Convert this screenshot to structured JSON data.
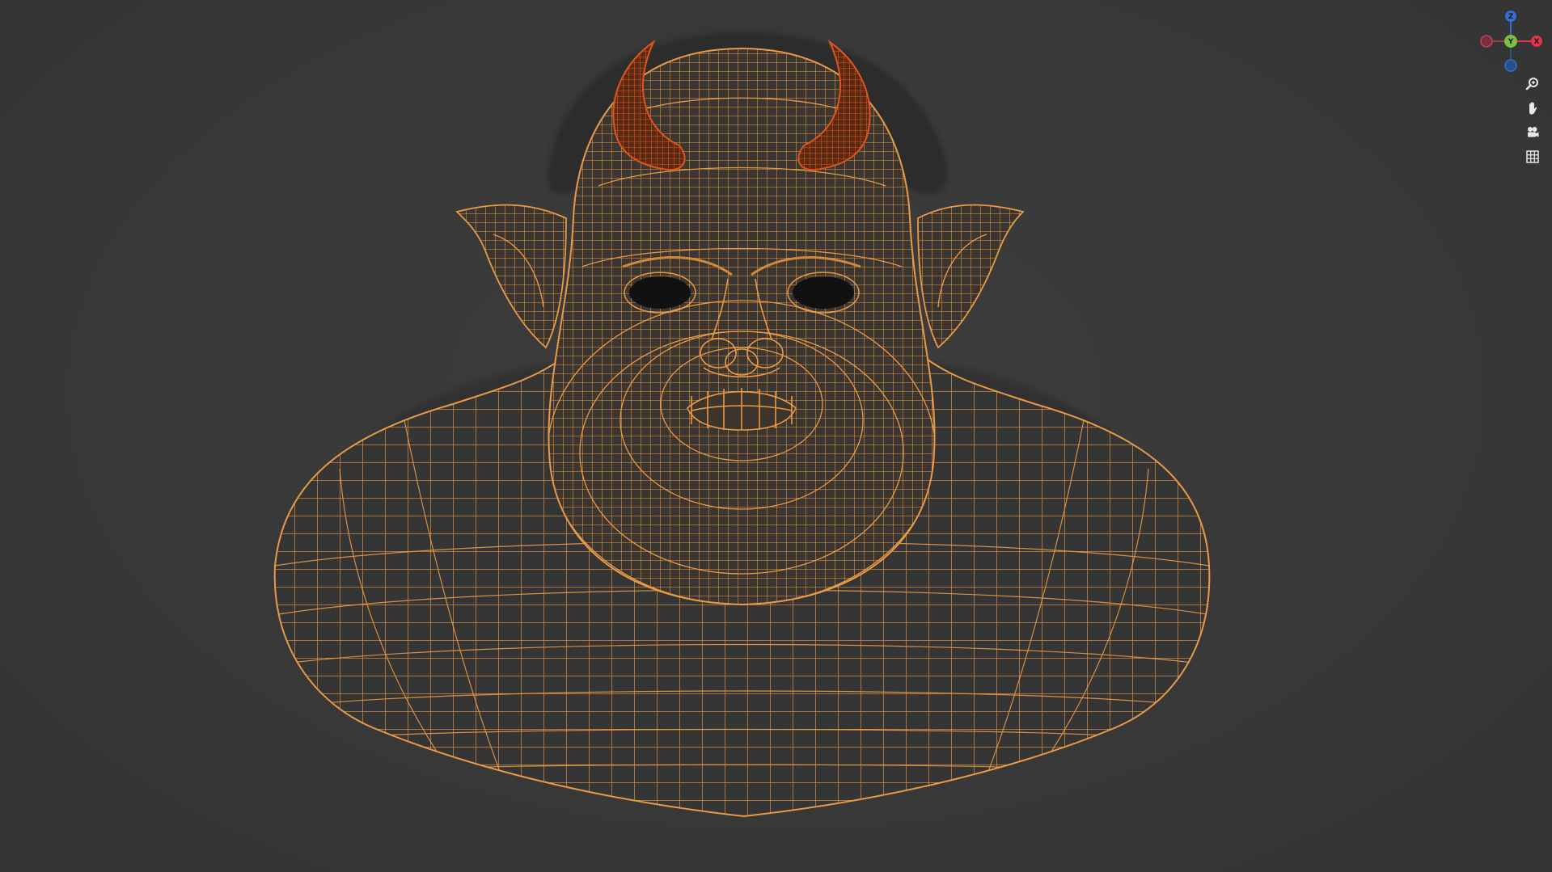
{
  "viewport": {
    "background": "#3a3a3a",
    "shading": "wireframe",
    "wire_color": "#e99a46",
    "horn_color": "#e0551c"
  },
  "gizmo": {
    "axes": [
      {
        "label": "Z",
        "color": "#2f6fd6"
      },
      {
        "label": "Y",
        "color": "#7bc043"
      },
      {
        "label": "X",
        "color": "#e0344f"
      }
    ]
  },
  "nav_tools": [
    {
      "name": "zoom",
      "icon": "zoom-icon"
    },
    {
      "name": "pan",
      "icon": "hand-icon"
    },
    {
      "name": "camera",
      "icon": "camera-icon"
    },
    {
      "name": "grid",
      "icon": "grid-icon"
    }
  ]
}
